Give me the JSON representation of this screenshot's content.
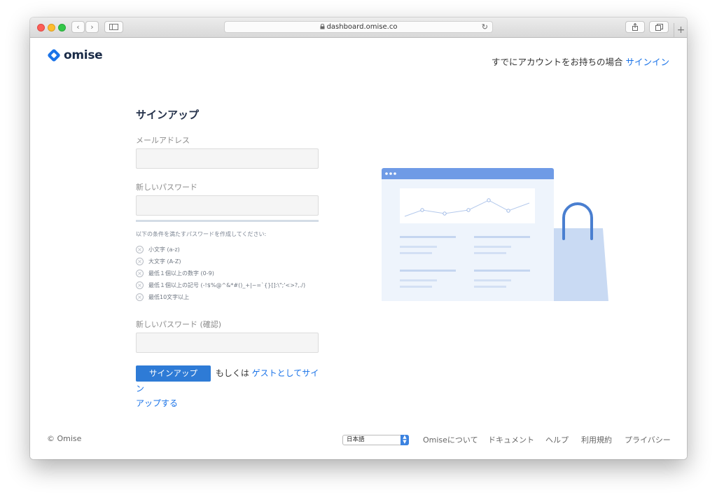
{
  "browser": {
    "url": "dashboard.omise.co",
    "new_tab_label": "+"
  },
  "header": {
    "logo_text": "omise",
    "have_account_text": "すでにアカウントをお持ちの場合",
    "signin_link": "サインイン"
  },
  "form": {
    "title": "サインアップ",
    "email_label": "メールアドレス",
    "email_value": "",
    "password_label": "新しいパスワード",
    "password_value": "",
    "password_hint": "以下の条件を満たすパスワードを作成してください:",
    "rules": [
      "小文字 (a-z)",
      "大文字 (A-Z)",
      "最低１個以上の数字 (0-9)",
      "最低１個以上の記号 (-!$%@^&*#()_+|~=`{}[]:\\\";'<>?,./)",
      "最低10文字以上"
    ],
    "confirm_label": "新しいパスワード (確認)",
    "confirm_value": "",
    "submit_label": "サインアップ",
    "or_text": "もしくは",
    "guest_link_part1": "ゲストとしてサイン",
    "guest_link_part2": "アップする"
  },
  "footer": {
    "copyright": "© Omise",
    "language_selected": "日本語",
    "links": [
      "Omiseについて",
      "ドキュメント",
      "ヘルプ",
      "利用規約",
      "プライバシー"
    ]
  },
  "colors": {
    "brand": "#1a73e8",
    "button": "#2e7bd6",
    "illustration_header": "#6f9be6",
    "bag": "#c9daf3"
  },
  "icons": [
    "back-icon",
    "forward-icon",
    "sidebar-icon",
    "lock-icon",
    "reload-icon",
    "share-icon",
    "tabs-icon",
    "x-circle-icon",
    "omise-logo-icon"
  ]
}
